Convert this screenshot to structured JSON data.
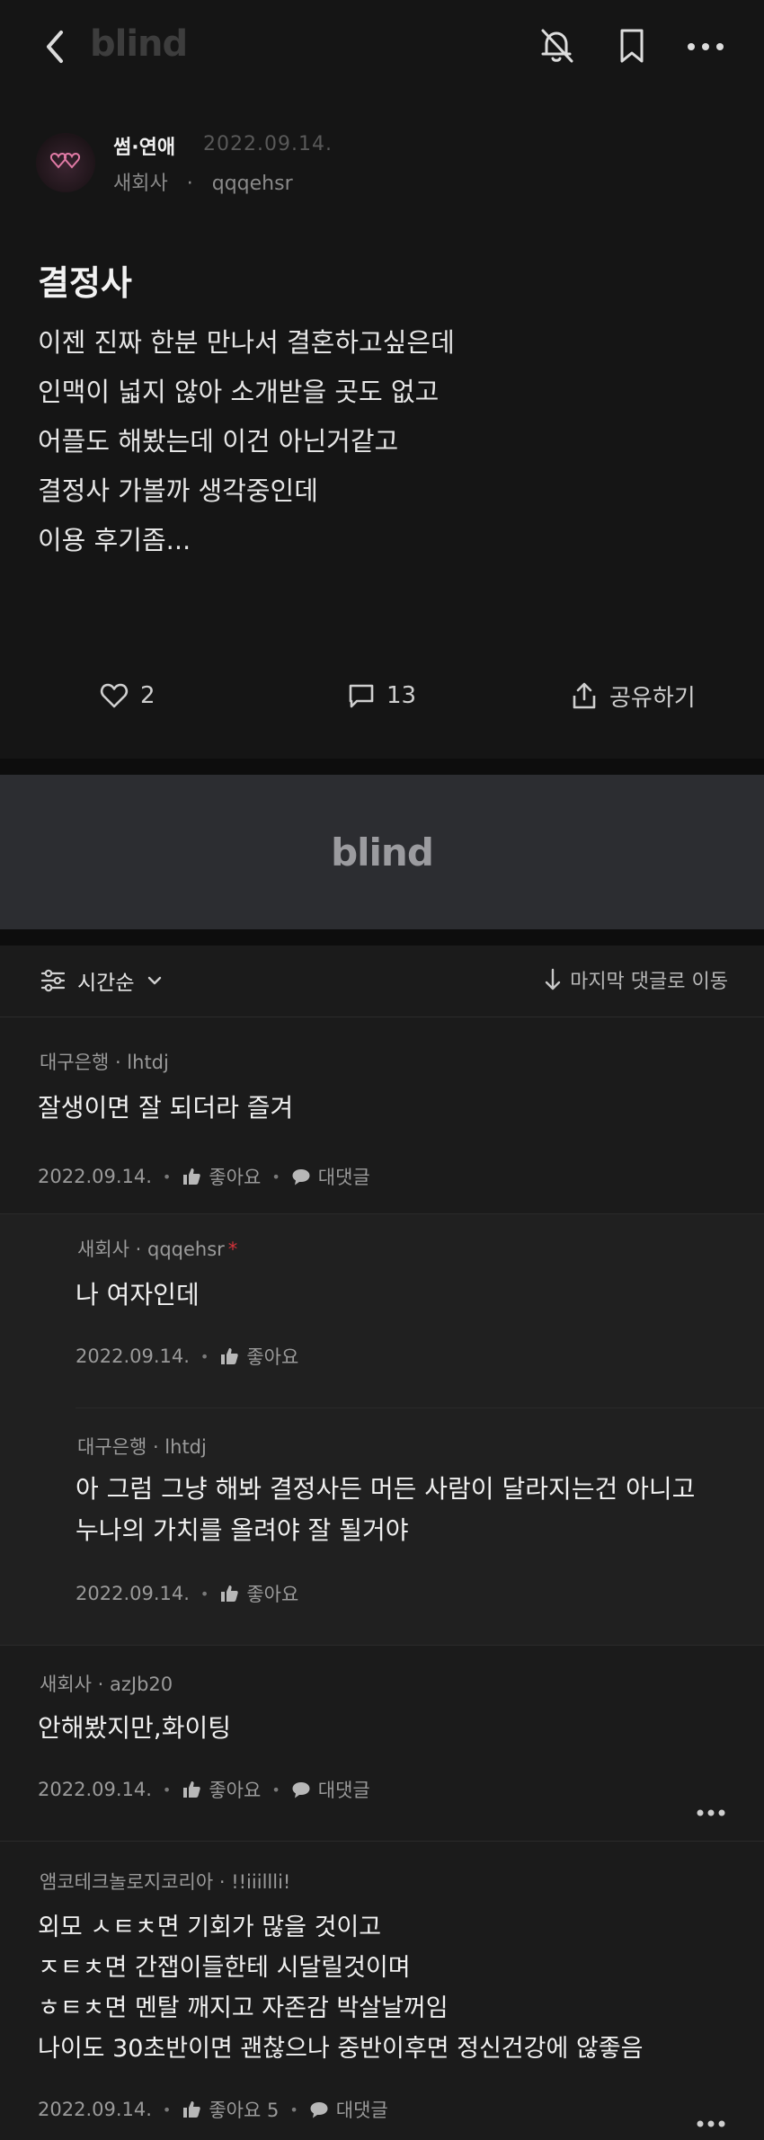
{
  "header": {
    "app_name": "blind",
    "icons": [
      "back-icon",
      "notification-off-icon",
      "bookmark-icon",
      "more-icon"
    ]
  },
  "post": {
    "board": "썸·연애",
    "date": "2022.09.14.",
    "company": "새회사",
    "username": "qqqehsr",
    "title": "결정사",
    "body": [
      "이젠 진짜 한분 만나서 결혼하고싶은데",
      "인맥이 넓지 않아 소개받을 곳도 없고",
      "어플도 해봤는데 이건 아닌거같고",
      "결정사 가볼까 생각중인데",
      "이용 후기좀..."
    ],
    "likes": "2",
    "comments": "13",
    "share_label": "공유하기"
  },
  "banner": {
    "logo": "blind"
  },
  "sort": {
    "label": "시간순",
    "jump_label": "마지막 댓글로 이동"
  },
  "comments": [
    {
      "meta": "대구은행 · lhtdj",
      "text": [
        "잘생이면 잘 되더라 즐겨"
      ],
      "date": "2022.09.14.",
      "like_label": "좋아요",
      "reply_label": "대댓글"
    },
    {
      "meta": "새회사 · qqqehsr",
      "author_mark": "*",
      "text": [
        "나 여자인데"
      ],
      "date": "2022.09.14.",
      "like_label": "좋아요"
    },
    {
      "meta": "대구은행 · lhtdj",
      "text": [
        "아 그럼 그냥 해봐 결정사든 머든 사람이 달라지는건 아니고",
        "누나의 가치를 올려야 잘 될거야"
      ],
      "date": "2022.09.14.",
      "like_label": "좋아요"
    },
    {
      "meta": "새회사 · azJb20",
      "text": [
        "안해봤지만,화이팅"
      ],
      "date": "2022.09.14.",
      "like_label": "좋아요",
      "reply_label": "대댓글"
    },
    {
      "meta": "앰코테크놀로지코리아 · !!iiillli!",
      "text": [
        "외모 ㅅㅌㅊ면 기회가 많을 것이고",
        "ㅈㅌㅊ면 간잽이들한테 시달릴것이며",
        "ㅎㅌㅊ면 멘탈 깨지고 자존감 박살날꺼임",
        "나이도 30초반이면 괜찮으나 중반이후면 정신건강에 않좋음"
      ],
      "date": "2022.09.14.",
      "like_label": "좋아요 5",
      "reply_label": "대댓글"
    }
  ]
}
